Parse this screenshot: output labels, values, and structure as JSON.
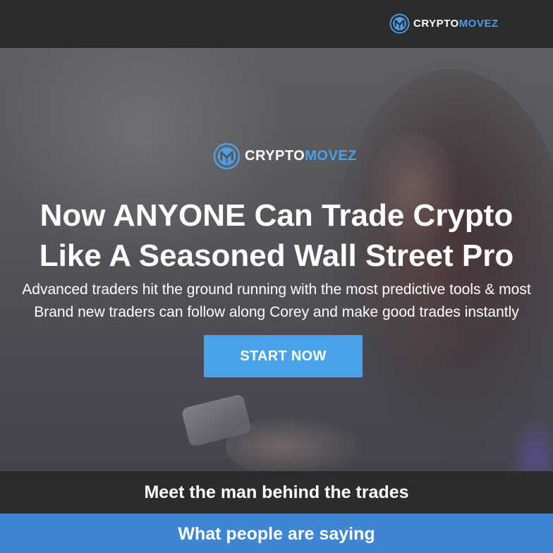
{
  "nav": {
    "brand": {
      "word_part1": "CRYPTO",
      "word_part2": "MOVEZ",
      "icon": "cryptomovez-logo-icon"
    }
  },
  "hero": {
    "brand": {
      "word_part1": "CRYPTO",
      "word_part2": "MOVEZ",
      "icon": "cryptomovez-logo-icon"
    },
    "headline_line1": "Now ANYONE Can Trade Crypto",
    "headline_line2": "Like A Seasoned Wall Street Pro",
    "subtext_line1": "Advanced traders hit the ground running with the most predictive tools & most",
    "subtext_line2": "Brand new traders can follow along Corey and make good trades instantly",
    "cta_label": "START NOW"
  },
  "sections": {
    "meet_title": "Meet the man behind the trades",
    "testimonials_title": "What people are saying"
  },
  "colors": {
    "accent": "#4aa3e8",
    "brand_blue": "#4a9fe6",
    "dark_bar": "#2c2c2c",
    "testimonials_bar": "#3f86d2"
  }
}
